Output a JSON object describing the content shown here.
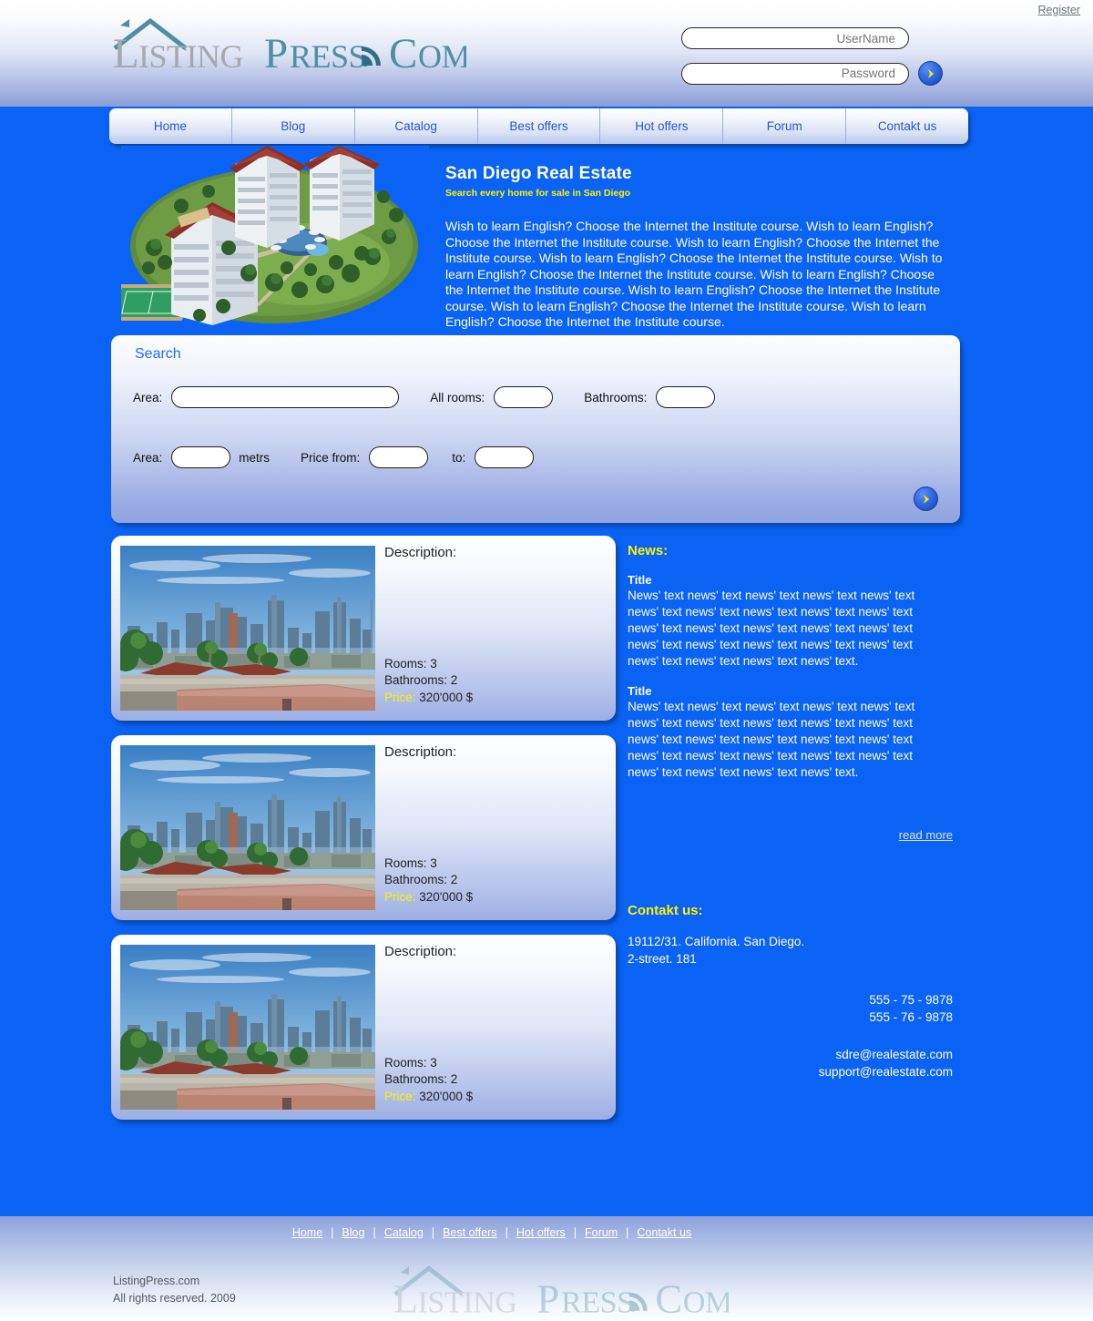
{
  "brand": {
    "name_part1": "Listing",
    "name_part2": "Press",
    "name_part3": "COM",
    "rss_icon": "rss-icon",
    "house_icon": "house-roof-icon"
  },
  "header": {
    "register_label": "Register",
    "username_placeholder": "UserName",
    "password_placeholder": "Password",
    "username_value": "",
    "password_value": "",
    "submit_icon": "chevron-right-icon"
  },
  "nav": {
    "items": [
      {
        "label": "Home"
      },
      {
        "label": "Blog"
      },
      {
        "label": "Catalog"
      },
      {
        "label": "Best offers"
      },
      {
        "label": "Hot offers"
      },
      {
        "label": "Forum"
      },
      {
        "label": "Contakt us"
      }
    ]
  },
  "hero": {
    "image_alt": "aerial-apartment-complex-render",
    "title": "San Diego Real Estate",
    "subtitle": "Search every home for sale in San Diego",
    "body": "Wish to learn English? Choose the Internet the Institute course. Wish to learn English? Choose the Internet the Institute course. Wish to learn English? Choose the Internet the Institute course. Wish to learn English? Choose the Internet the Institute course. Wish to learn English? Choose the Internet the Institute course. Wish to learn English? Choose the Internet the Institute course. Wish to learn English? Choose the Internet the Institute course. Wish to learn English? Choose the Internet the Institute course. Wish to learn English? Choose the Internet the Institute course."
  },
  "search": {
    "title": "Search",
    "area_label": "Area:",
    "area_value": "",
    "rooms_label": "All rooms:",
    "rooms_value": "",
    "bathrooms_label": "Bathrooms:",
    "bathrooms_value": "",
    "area2_label": "Area:",
    "area2_value": "",
    "metrs_label": "metrs",
    "price_from_label": "Price from:",
    "price_from_value": "",
    "price_to_label": "to:",
    "price_to_value": "",
    "submit_icon": "chevron-right-icon"
  },
  "listings": [
    {
      "image_alt": "san-diego-skyline-photo",
      "description_label": "Description:",
      "rooms": "Rooms: 3",
      "bathrooms": "Bathrooms: 2",
      "price_label": "Price:",
      "price_value": "320'000 $"
    },
    {
      "image_alt": "san-diego-skyline-photo",
      "description_label": "Description:",
      "rooms": "Rooms: 3",
      "bathrooms": "Bathrooms: 2",
      "price_label": "Price:",
      "price_value": "320'000 $"
    },
    {
      "image_alt": "san-diego-skyline-photo",
      "description_label": "Description:",
      "rooms": "Rooms: 3",
      "bathrooms": "Bathrooms: 2",
      "price_label": "Price:",
      "price_value": "320'000 $"
    }
  ],
  "news": {
    "heading": "News:",
    "items": [
      {
        "title": "Title",
        "body": "News' text news' text news' text news' text news' text news' text news' text news' text news' text news' text news' text news' text news' text news' text news' text news' text news' text news' text news' text news' text news' text news' text news' text news' text."
      },
      {
        "title": "Title",
        "body": "News' text news' text news' text news' text news' text news' text news' text news' text news' text news' text news' text news' text news' text news' text news' text news' text news' text news' text news' text news' text news' text news' text news' text news' text."
      }
    ],
    "read_more_label": "read more"
  },
  "contact": {
    "heading": "Contakt us:",
    "address_line1": "19112/31.  California. San Diego.",
    "address_line2": "2-street. 181",
    "phone1": "555 - 75 - 9878",
    "phone2": "555 - 76 - 9878",
    "email1": "sdre@realestate.com",
    "email2": "support@realestate.com"
  },
  "footer": {
    "links": [
      {
        "label": "Home"
      },
      {
        "label": "Blog"
      },
      {
        "label": "Catalog"
      },
      {
        "label": "Best offers"
      },
      {
        "label": "Hot offers"
      },
      {
        "label": "Forum"
      },
      {
        "label": "Contakt us"
      }
    ],
    "separator": "|",
    "copyright_line1": "ListingPress.com",
    "copyright_line2": "All rights reserved. 2009"
  },
  "colors": {
    "page_blue": "#0a63f5",
    "accent_yellow": "#fff200",
    "nav_link_blue": "#2257d9",
    "logo_gray": "#a6a8ab",
    "logo_teal": "#4f8fa6"
  }
}
